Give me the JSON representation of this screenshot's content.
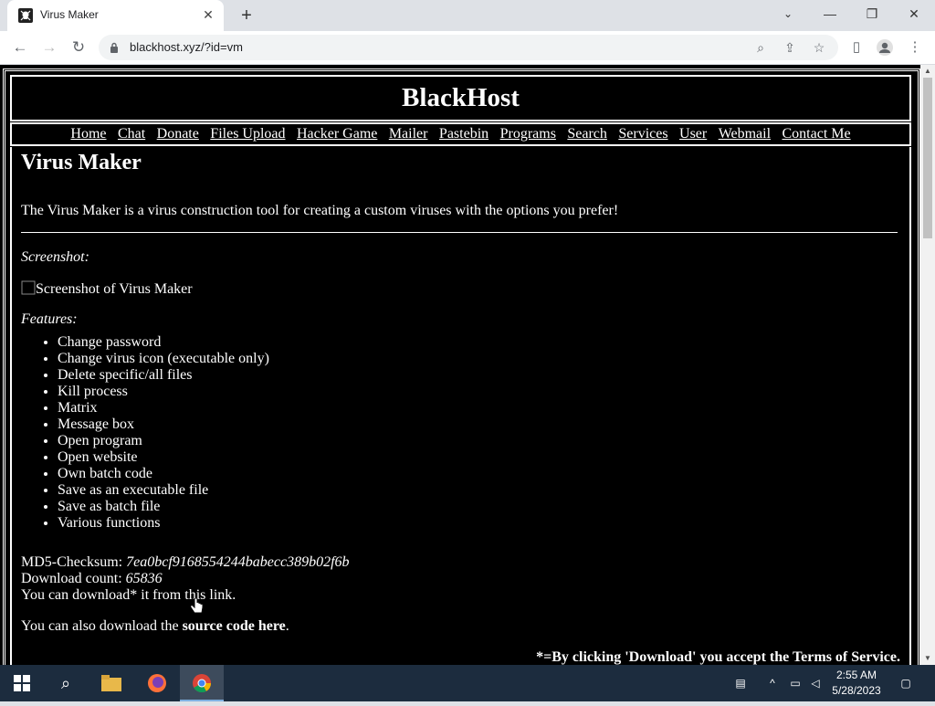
{
  "browser": {
    "tab_title": "Virus Maker",
    "tab_close": "✕",
    "new_tab": "+",
    "url": "blackhost.xyz/?id=vm",
    "window_minimize": "—",
    "window_restore": "❐",
    "window_close": "✕"
  },
  "site": {
    "title": "BlackHost",
    "nav": [
      "Home",
      "Chat",
      "Donate",
      "Files Upload",
      "Hacker Game",
      "Mailer",
      "Pastebin",
      "Programs",
      "Search",
      "Services",
      "User",
      "Webmail",
      "Contact Me"
    ]
  },
  "page": {
    "heading": "Virus Maker",
    "description": "The Virus Maker is a virus construction tool for creating a custom viruses with the options you prefer!",
    "screenshot_label": "Screenshot:",
    "screenshot_alt": "Screenshot of Virus Maker",
    "features_label": "Features:",
    "features": [
      "Change password",
      "Change virus icon (executable only)",
      "Delete specific/all files",
      "Kill process",
      "Matrix",
      "Message box",
      "Open program",
      "Open website",
      "Own batch code",
      "Save as an executable file",
      "Save as batch file",
      "Various functions"
    ],
    "md5_label": "MD5-Checksum: ",
    "md5_value": "7ea0bcf9168554244babecc389b02f6b",
    "download_count_label": "Download count: ",
    "download_count_value": "65836",
    "download_prefix": "You can download* it from ",
    "download_link": "this",
    "download_suffix": " link.",
    "source_prefix": "You can also download the ",
    "source_bold": "source code",
    "source_link": "here",
    "source_suffix": ".",
    "tos_prefix": "*=By clicking 'Download' you accept the ",
    "tos_link": "Terms of Service",
    "tos_suffix": "."
  },
  "taskbar": {
    "time": "2:55 AM",
    "date": "5/28/2023"
  }
}
